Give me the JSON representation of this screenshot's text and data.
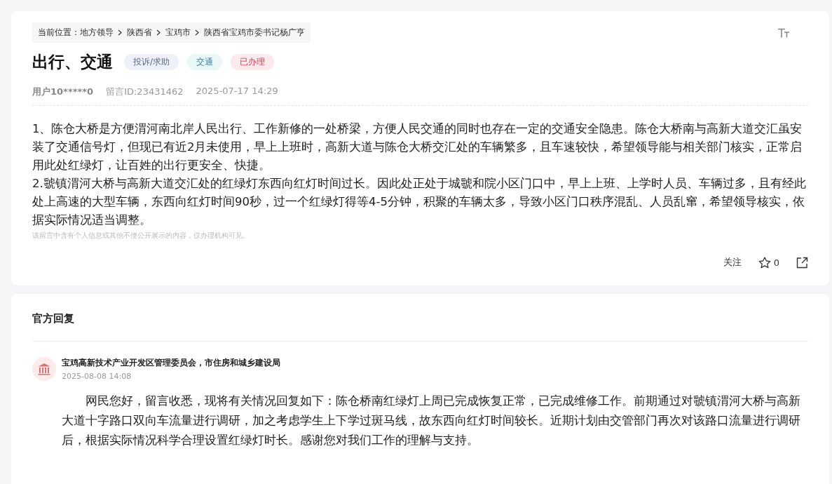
{
  "breadcrumb": {
    "label": "当前位置：",
    "items": [
      "地方领导",
      "陕西省",
      "宝鸡市",
      "陕西省宝鸡市委书记杨广亨"
    ]
  },
  "title": "出行、交通",
  "tags": [
    {
      "label": "投诉/求助",
      "color": "#eef2f8"
    },
    {
      "label": "交通",
      "color": "#eaf7f7"
    },
    {
      "label": "已办理",
      "color": "#fbe9eb"
    }
  ],
  "meta": {
    "user": "用户10*****0",
    "message_id": "留言ID:23431462",
    "time": "2025-07-17 14:29"
  },
  "paragraphs": [
    "1、陈仓大桥是方便渭河南北岸人民出行、工作新修的一处桥梁，方便人民交通的同时也存在一定的交通安全隐患。陈仓大桥南与高新大道交汇虽安装了交通信号灯，但现已有近2月未使用，早上上班时，高新大道与陈仓大桥交汇处的车辆繁多，且车速较快，希望领导能与相关部门核实，正常启用此处红绿灯，让百姓的出行更安全、快捷。",
    "2.虢镇渭河大桥与高新大道交汇处的红绿灯东西向红灯时间过长。因此处正处于城虢和院小区门口中，早上上班、上学时人员、车辆过多，且有经此处上高速的大型车辆，东西向红灯时间90秒，过一个红绿灯得等4-5分钟，积聚的车辆太多，导致小区门口秩序混乱、人员乱窜，希望领导核实，依据实际情况适当调整。"
  ],
  "privacy_note": "该留言中含有个人信息或其他不便公开展示的内容，仅办理机构可见。",
  "actions": {
    "follow": "关注",
    "likes": "0"
  },
  "reply": {
    "heading": "官方回复",
    "org": "宝鸡高新技术产业开发区管理委员会，市住房和城乡建设局",
    "time": "2025-08-08 14:08",
    "text": "网民您好，留言收悉，现将有关情况回复如下：陈仓桥南红绿灯上周已完成恢复正常，已完成维修工作。前期通过对虢镇渭河大桥与高新大道十字路口双向车流量进行调研，加之考虑学生上下学过斑马线，故东西向红灯时间较长。近期计划由交管部门再次对该路口流量进行调研后，根据实际情况科学合理设置红绿灯时长。感谢您对我们工作的理解与支持。"
  }
}
